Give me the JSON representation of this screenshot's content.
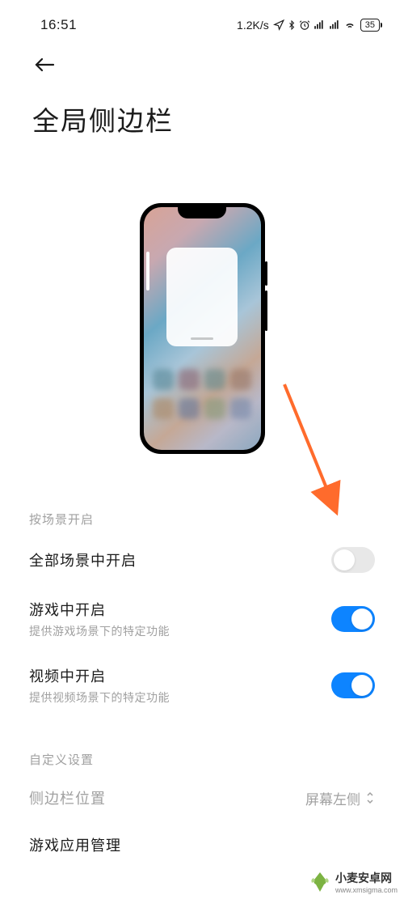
{
  "status_bar": {
    "time": "16:51",
    "network_speed": "1.2K/s",
    "battery_level": "35"
  },
  "page": {
    "title": "全局侧边栏"
  },
  "sections": {
    "scene_header": "按场景开启",
    "custom_header": "自定义设置"
  },
  "settings": {
    "all_scenes": {
      "title": "全部场景中开启",
      "enabled": false
    },
    "game": {
      "title": "游戏中开启",
      "subtitle": "提供游戏场景下的特定功能",
      "enabled": true
    },
    "video": {
      "title": "视频中开启",
      "subtitle": "提供视频场景下的特定功能",
      "enabled": true
    },
    "sidebar_position": {
      "title": "侧边栏位置",
      "value": "屏幕左侧"
    },
    "game_app_manage": {
      "title": "游戏应用管理"
    }
  },
  "watermark": {
    "title": "小麦安卓网",
    "url": "www.xmsigma.com"
  },
  "colors": {
    "accent": "#0d84ff",
    "arrow": "#ff6b2c"
  }
}
